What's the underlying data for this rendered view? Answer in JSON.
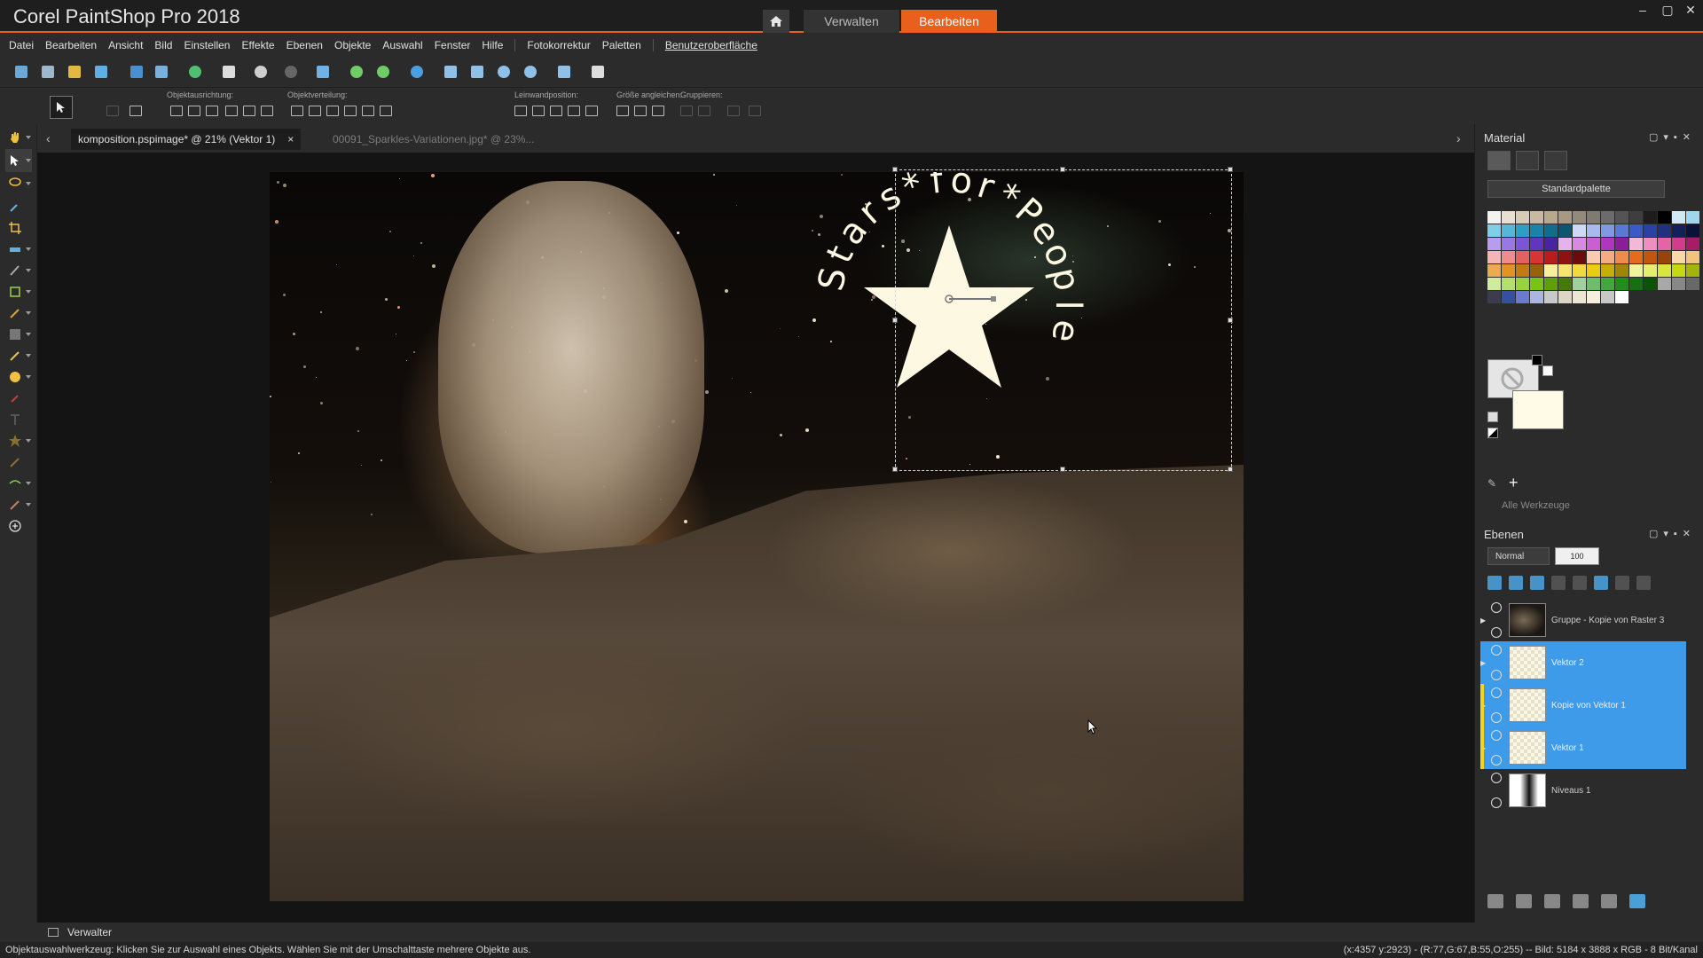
{
  "app": {
    "title": "Corel PaintShop Pro 2018",
    "tabs": {
      "manage": "Verwalten",
      "edit": "Bearbeiten"
    },
    "window_controls": [
      "–",
      "▢",
      "✕"
    ],
    "accent_color": "#e8601c"
  },
  "menu": [
    "Datei",
    "Bearbeiten",
    "Ansicht",
    "Bild",
    "Einstellen",
    "Effekte",
    "Ebenen",
    "Objekte",
    "Auswahl",
    "Fenster",
    "Hilfe",
    "Fotokorrektur",
    "Paletten",
    "Benutzeroberfläche"
  ],
  "options": {
    "align_label": "Objektausrichtung:",
    "distribute_label": "Objektverteilung:",
    "canvas_pos_label": "Leinwandposition:",
    "size_label": "Größe angleichen:",
    "group_label": "Gruppieren:"
  },
  "documents": {
    "active": "komposition.pspimage* @  21% (Vektor 1)",
    "inactive": "00091_Sparkles-Variationen.jpg* @  23%...",
    "close": "×"
  },
  "canvas_text": {
    "arc_text": "Stars * for * People",
    "letters": [
      "S",
      "t",
      "a",
      "r",
      "s",
      "*",
      "f",
      "o",
      "r",
      "*",
      "P",
      "e",
      "o",
      "p",
      "l",
      "e"
    ]
  },
  "material": {
    "title": "Material",
    "palette": "Standardpalette",
    "all_tools": "Alle Werkzeuge"
  },
  "layers": {
    "title": "Ebenen",
    "blend_mode": "Normal",
    "opacity": "100",
    "items": [
      {
        "name": "Gruppe - Kopie von Raster 3",
        "selected": false
      },
      {
        "name": "Vektor 2",
        "selected": true
      },
      {
        "name": "Kopie von Vektor 1",
        "selected": true
      },
      {
        "name": "Vektor 1",
        "selected": true
      },
      {
        "name": "Niveaus 1",
        "selected": false
      }
    ]
  },
  "bottom": {
    "verwalter": "Verwalter",
    "status_left": "Objektauswahlwerkzeug: Klicken Sie zur Auswahl eines Objekts. Wählen Sie mit der Umschalttaste mehrere Objekte aus.",
    "status_right": "(x:4357 y:2923) - (R:77,G:67,B:55,O:255) -- Bild: 5184 x 3888 x RGB - 8 Bit/Kanal"
  },
  "icons": [
    "home-icon",
    "pan-icon",
    "pick-icon",
    "lasso-icon",
    "crop-icon",
    "text-icon",
    "star-icon",
    "add-icon"
  ]
}
